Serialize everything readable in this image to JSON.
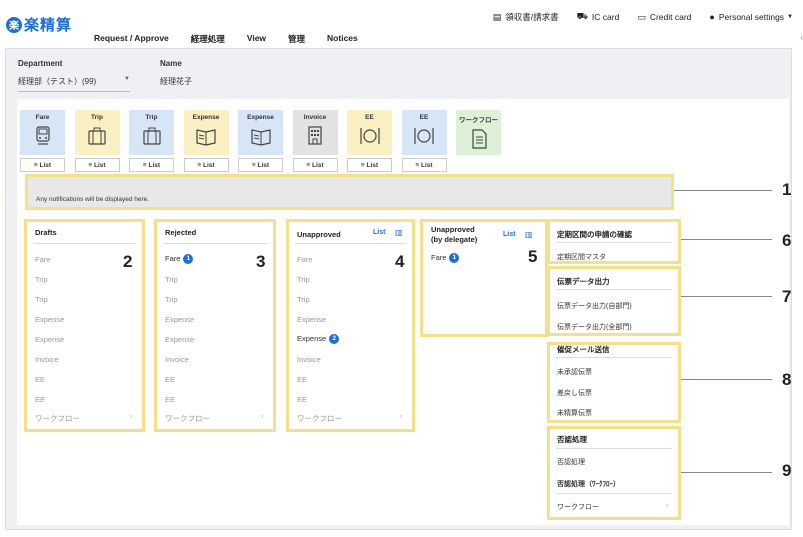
{
  "app": {
    "logo_mark": "楽",
    "logo_text": "楽精算"
  },
  "nav": [
    "Request / Approve",
    "経理処理",
    "View",
    "管理",
    "Notices"
  ],
  "utility": [
    {
      "icon": "receipt-icon",
      "glyph": "▤",
      "label": "領収書/請求書"
    },
    {
      "icon": "ic-card-icon",
      "glyph": "⛟",
      "label": "IC card"
    },
    {
      "icon": "credit-card-icon",
      "glyph": "▭",
      "label": "Credit card"
    },
    {
      "icon": "person-icon",
      "glyph": "●",
      "label": "Personal settings"
    }
  ],
  "fields": {
    "department_label": "Department",
    "department_value": "経理部（テスト）(99)",
    "name_label": "Name",
    "name_value": "経理花子"
  },
  "tiles": [
    {
      "label": "Fare",
      "icon": "train-icon",
      "color": "#d6e6f6",
      "list": "List"
    },
    {
      "label": "Trip",
      "icon": "suitcase-icon",
      "color": "#fbf0c4",
      "list": "List"
    },
    {
      "label": "Trip",
      "icon": "suitcase-icon",
      "color": "#d6e6f6",
      "list": "List"
    },
    {
      "label": "Expense",
      "icon": "book-icon",
      "color": "#fbf0c4",
      "list": "List"
    },
    {
      "label": "Expense",
      "icon": "book-icon",
      "color": "#d6e6f6",
      "list": "List"
    },
    {
      "label": "Invoice",
      "icon": "building-icon",
      "color": "#e2e2e2",
      "list": "List"
    },
    {
      "label": "EE",
      "icon": "dining-icon",
      "color": "#fbf0c4",
      "list": "List"
    },
    {
      "label": "EE",
      "icon": "dining-icon",
      "color": "#d6e6f6",
      "list": "List"
    },
    {
      "label": "ワークフロー",
      "icon": "document-icon",
      "color": "#dcf1d8",
      "list": ""
    }
  ],
  "notification": "Any notifications will be displayed here.",
  "panels": {
    "drafts": {
      "title": "Drafts",
      "number": "2",
      "rows": [
        "Fare",
        "Trip",
        "Trip",
        "Expense",
        "Expense",
        "Invoice",
        "EE",
        "EE",
        "ワークフロー"
      ]
    },
    "rejected": {
      "title": "Rejected",
      "number": "3",
      "rows": [
        "Fare",
        "Trip",
        "Trip",
        "Expense",
        "Expense",
        "Invoice",
        "EE",
        "EE",
        "ワークフロー"
      ],
      "fare_badge": "1"
    },
    "unapproved": {
      "title": "Unapproved",
      "number": "4",
      "list_link": "List",
      "rows": [
        "Fare",
        "Trip",
        "Trip",
        "Expense",
        "Expense",
        "Invoice",
        "EE",
        "EE",
        "ワークフロー"
      ],
      "expense_badge": "2"
    },
    "delegate": {
      "title_line1": "Unapproved",
      "title_line2": "(by delegate)",
      "number": "5",
      "list_link": "List",
      "row": "Fare",
      "badge": "1"
    }
  },
  "side": {
    "teiki": {
      "title": "定期区間の申請の確認",
      "item": "定期区間マスタ",
      "number": "6"
    },
    "denpyo": {
      "title": "伝票データ出力",
      "items": [
        "伝票データ出力(自部門)",
        "伝票データ出力(全部門)"
      ],
      "number": "7"
    },
    "mail": {
      "title": "催促メール送信",
      "items": [
        "未承認伝票",
        "差戻し伝票",
        "未精算伝票"
      ],
      "number": "8"
    },
    "hinin": {
      "title": "否認処理",
      "items": [
        "否認処理",
        "否認処理（ﾜｰｸﾌﾛｰ）",
        "ワークフロー"
      ],
      "number": "9"
    }
  },
  "callout_1": "1"
}
